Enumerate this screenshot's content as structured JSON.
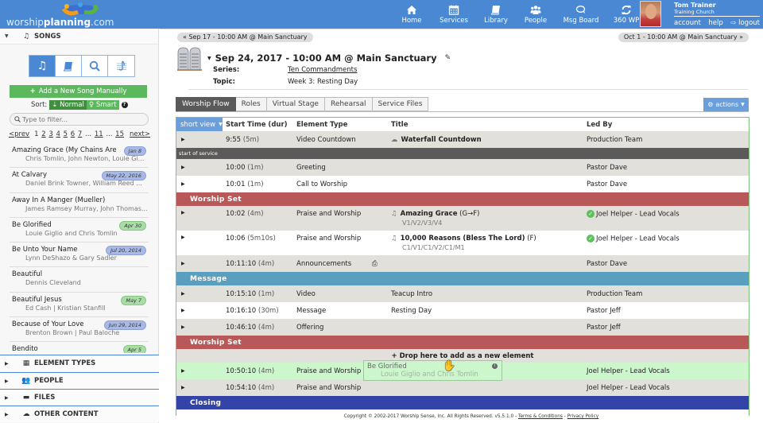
{
  "topbar": {
    "logo": {
      "prefix": "worship",
      "bold": "planning",
      "suffix": ".com"
    },
    "nav": [
      {
        "label": "Home",
        "icon": "home-icon"
      },
      {
        "label": "Services",
        "icon": "calendar-icon"
      },
      {
        "label": "Library",
        "icon": "book-icon"
      },
      {
        "label": "People",
        "icon": "people-icon"
      },
      {
        "label": "Msg Board",
        "icon": "chat-icon"
      },
      {
        "label": "360 WP",
        "icon": "refresh-icon"
      }
    ],
    "user": {
      "name": "Tom Trainer",
      "church": "Training Church",
      "links": {
        "account": "account",
        "help": "help",
        "logout": "logout"
      }
    }
  },
  "sidebar": {
    "songs_header": "SONGS",
    "add_song_label": "Add a New Song Manually",
    "sort": {
      "label": "Sort:",
      "normal": "Normal",
      "smart": "Smart",
      "help": "?"
    },
    "filter_placeholder": "Type to filter...",
    "pager": {
      "prev": "<prev",
      "pages": [
        "1",
        "2",
        "3",
        "4",
        "5",
        "6",
        "7",
        "...",
        "11",
        "...",
        "15"
      ],
      "next": "next>"
    },
    "songs": [
      {
        "title": "Amazing Grace (My Chains Are ...",
        "authors": "Chris Tomlin, John Newton, Louie Gi...",
        "badge": "Jan 8",
        "badge_color": "blue"
      },
      {
        "title": "At Calvary",
        "authors": "Daniel Brink Towner, William Reed ...",
        "badge": "May 22, 2016",
        "badge_color": "blue"
      },
      {
        "title": "Away In A Manger (Mueller)",
        "authors": "James Ramsey Murray, John Thomas...",
        "badge": "",
        "badge_color": ""
      },
      {
        "title": "Be Glorified",
        "authors": "Louie Giglio and Chris Tomlin",
        "badge": "Apr 30",
        "badge_color": "green"
      },
      {
        "title": "Be Unto Your Name",
        "authors": "Lynn DeShazo & Gary Sadler",
        "badge": "Jul 20, 2014",
        "badge_color": "blue"
      },
      {
        "title": "Beautiful",
        "authors": "Dennis Cleveland",
        "badge": "",
        "badge_color": ""
      },
      {
        "title": "Beautiful Jesus",
        "authors": "Ed Cash | Kristian Stanfill",
        "badge": "May 7",
        "badge_color": "green"
      },
      {
        "title": "Because of Your Love",
        "authors": "Brenton Brown | Paul Baloche",
        "badge": "Jun 29, 2014",
        "badge_color": "blue"
      },
      {
        "title": "Bendito",
        "authors": "",
        "badge": "Apr 5",
        "badge_color": "green"
      }
    ],
    "panels": [
      {
        "label": "ELEMENT TYPES",
        "icon": "grid-icon"
      },
      {
        "label": "PEOPLE",
        "icon": "people-icon"
      },
      {
        "label": "FILES",
        "icon": "folder-icon"
      },
      {
        "label": "OTHER CONTENT",
        "icon": "cloud-icon"
      }
    ]
  },
  "service": {
    "prev_service": "« Sep 17 - 10:00 AM @ Main Sanctuary",
    "next_service": "Oct 1 - 10:00 AM @ Main Sanctuary »",
    "title": "Sep 24, 2017 - 10:00 AM @ Main Sanctuary",
    "series_label": "Series:",
    "series_value": "Ten Commandments",
    "topic_label": "Topic:",
    "topic_value": "Week 3: Resting Day",
    "tabs": [
      "Worship Flow",
      "Roles",
      "Virtual Stage",
      "Rehearsal",
      "Service Files"
    ],
    "active_tab": "Worship Flow",
    "actions_label": "actions"
  },
  "flow": {
    "view_label": "short view",
    "columns": {
      "time": "Start Time (dur)",
      "type": "Element Type",
      "title": "Title",
      "led": "Led By"
    },
    "rows": [
      {
        "time": "9:55",
        "dur": "(5m)",
        "type": "Video Countdown",
        "title": "Waterfall Countdown",
        "led": "Production Team"
      },
      {
        "divider": "start of service"
      },
      {
        "time": "10:00",
        "dur": "(1m)",
        "type": "Greeting",
        "title": "",
        "led": "Pastor Dave"
      },
      {
        "time": "10:01",
        "dur": "(1m)",
        "type": "Call to Worship",
        "title": "",
        "led": "Pastor Dave"
      },
      {
        "section": "Worship Set"
      },
      {
        "time": "10:02",
        "dur": "(4m)",
        "type": "Praise and Worship",
        "title": "Amazing Grace",
        "key": "(G→F)",
        "arrangement": "V1/V2/V3/V4",
        "led": "Joel Helper - Lead Vocals"
      },
      {
        "time": "10:06",
        "dur": "(5m10s)",
        "type": "Praise and Worship",
        "title": "10,000 Reasons (Bless The Lord)",
        "key": "(F)",
        "arrangement": "C1/V1/C1/V2/C1/M1",
        "led": "Joel Helper - Lead Vocals"
      },
      {
        "time": "10:11:10",
        "dur": "(4m)",
        "type": "Announcements",
        "title": "",
        "led": "Pastor Dave"
      },
      {
        "section": "Message"
      },
      {
        "time": "10:15:10",
        "dur": "(1m)",
        "type": "Video",
        "title": "Teacup Intro",
        "led": "Production Team"
      },
      {
        "time": "10:16:10",
        "dur": "(30m)",
        "type": "Message",
        "title": "Resting Day",
        "led": "Pastor Jeff"
      },
      {
        "time": "10:46:10",
        "dur": "(4m)",
        "type": "Offering",
        "title": "",
        "led": "Pastor Jeff"
      },
      {
        "section": "Worship Set"
      },
      {
        "drop": "+ Drop here to add as a new element"
      },
      {
        "time": "10:50:10",
        "dur": "(4m)",
        "type": "Praise and Worship",
        "title": "",
        "led": "Joel Helper - Lead Vocals"
      },
      {
        "time": "10:54:10",
        "dur": "(4m)",
        "type": "Praise and Worship",
        "title": "",
        "led": "Joel Helper - Lead Vocals"
      },
      {
        "section": "Closing"
      }
    ],
    "drag_card": {
      "title": "Be Glorified",
      "authors": "Louie Giglio and Chris Tomlin"
    }
  },
  "footer": {
    "copyright": "Copyright © 2002-2017 Worship Sense, Inc. All Rights Reserved. v5.5.1.0 - ",
    "terms": "Terms & Conditions",
    "sep": " - ",
    "privacy": "Privacy Policy"
  },
  "colors": {
    "brand_blue": "#4a88d4",
    "section_red": "#b85858",
    "section_blue": "#5a9ec0",
    "section_navy": "#3443a8",
    "add_green": "#5cb85c"
  }
}
